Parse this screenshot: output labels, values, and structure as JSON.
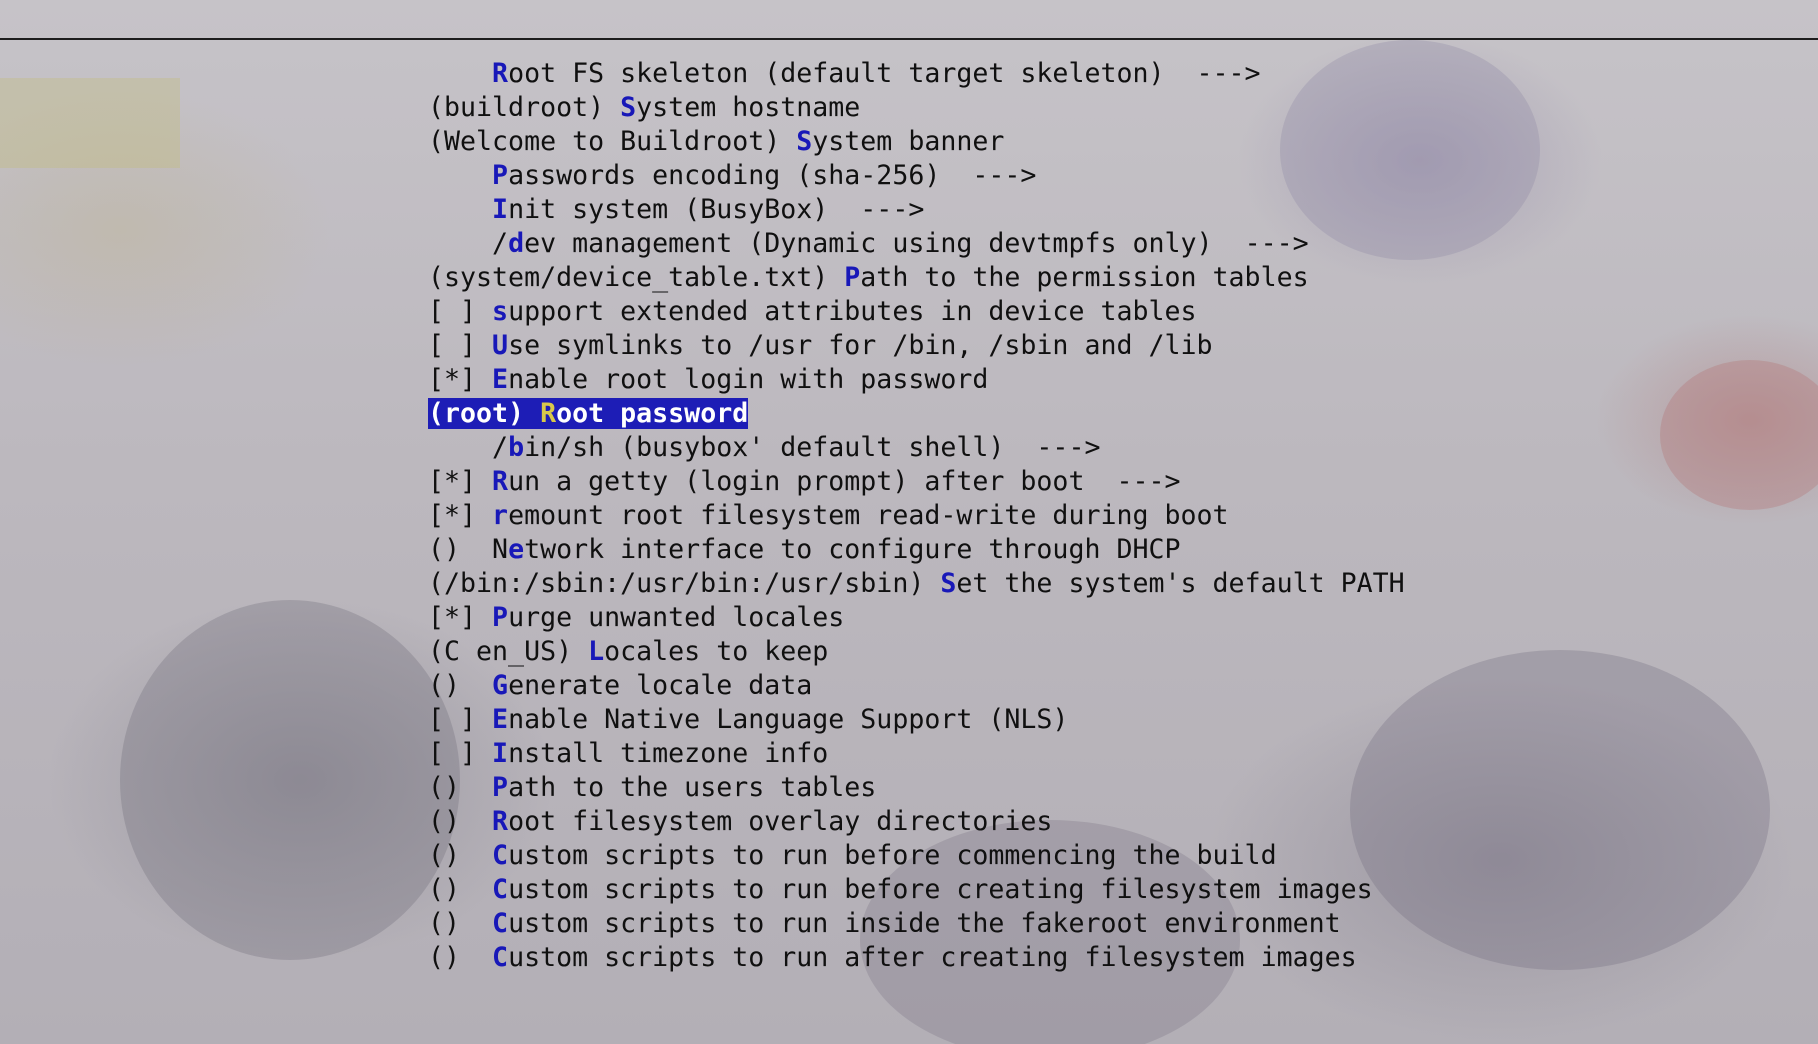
{
  "theme": {
    "background": "#bfbbc1",
    "text_color": "#101010",
    "hotkey_color": "#1818b8",
    "selected_bg": "#1d1db6",
    "selected_text": "#ffffff",
    "selected_hotkey": "#d8c84a"
  },
  "menu": {
    "selected_index": 10,
    "items": [
      {
        "prefix": "    ",
        "hotkey": "R",
        "rest": "oot FS skeleton (default target skeleton)  --->"
      },
      {
        "prefix": "(buildroot) ",
        "hotkey": "S",
        "rest": "ystem hostname"
      },
      {
        "prefix": "(Welcome to Buildroot) ",
        "hotkey": "S",
        "rest": "ystem banner"
      },
      {
        "prefix": "    ",
        "hotkey": "P",
        "rest": "asswords encoding (sha-256)  --->"
      },
      {
        "prefix": "    ",
        "hotkey": "I",
        "rest": "nit system (BusyBox)  --->"
      },
      {
        "prefix": "    /",
        "hotkey": "d",
        "rest": "ev management (Dynamic using devtmpfs only)  --->"
      },
      {
        "prefix": "(system/device_table.txt) ",
        "hotkey": "P",
        "rest": "ath to the permission tables"
      },
      {
        "prefix": "[ ] ",
        "hotkey": "s",
        "rest": "upport extended attributes in device tables"
      },
      {
        "prefix": "[ ] ",
        "hotkey": "U",
        "rest": "se symlinks to /usr for /bin, /sbin and /lib"
      },
      {
        "prefix": "[*] ",
        "hotkey": "E",
        "rest": "nable root login with password"
      },
      {
        "prefix": "(root) ",
        "hotkey": "R",
        "rest": "oot password"
      },
      {
        "prefix": "    /",
        "hotkey": "b",
        "rest": "in/sh (busybox' default shell)  --->"
      },
      {
        "prefix": "[*] ",
        "hotkey": "R",
        "rest": "un a getty (login prompt) after boot  --->"
      },
      {
        "prefix": "[*] ",
        "hotkey": "r",
        "rest": "emount root filesystem read-write during boot"
      },
      {
        "prefix": "()  N",
        "hotkey": "e",
        "rest": "twork interface to configure through DHCP"
      },
      {
        "prefix": "(/bin:/sbin:/usr/bin:/usr/sbin) ",
        "hotkey": "S",
        "rest": "et the system's default PATH"
      },
      {
        "prefix": "[*] ",
        "hotkey": "P",
        "rest": "urge unwanted locales"
      },
      {
        "prefix": "(C en_US) ",
        "hotkey": "L",
        "rest": "ocales to keep"
      },
      {
        "prefix": "()  ",
        "hotkey": "G",
        "rest": "enerate locale data"
      },
      {
        "prefix": "[ ] ",
        "hotkey": "E",
        "rest": "nable Native Language Support (NLS)"
      },
      {
        "prefix": "[ ] ",
        "hotkey": "I",
        "rest": "nstall timezone info"
      },
      {
        "prefix": "()  ",
        "hotkey": "P",
        "rest": "ath to the users tables"
      },
      {
        "prefix": "()  ",
        "hotkey": "R",
        "rest": "oot filesystem overlay directories"
      },
      {
        "prefix": "()  ",
        "hotkey": "C",
        "rest": "ustom scripts to run before commencing the build"
      },
      {
        "prefix": "()  ",
        "hotkey": "C",
        "rest": "ustom scripts to run before creating filesystem images"
      },
      {
        "prefix": "()  ",
        "hotkey": "C",
        "rest": "ustom scripts to run inside the fakeroot environment"
      },
      {
        "prefix": "()  ",
        "hotkey": "C",
        "rest": "ustom scripts to run after creating filesystem images"
      }
    ]
  }
}
